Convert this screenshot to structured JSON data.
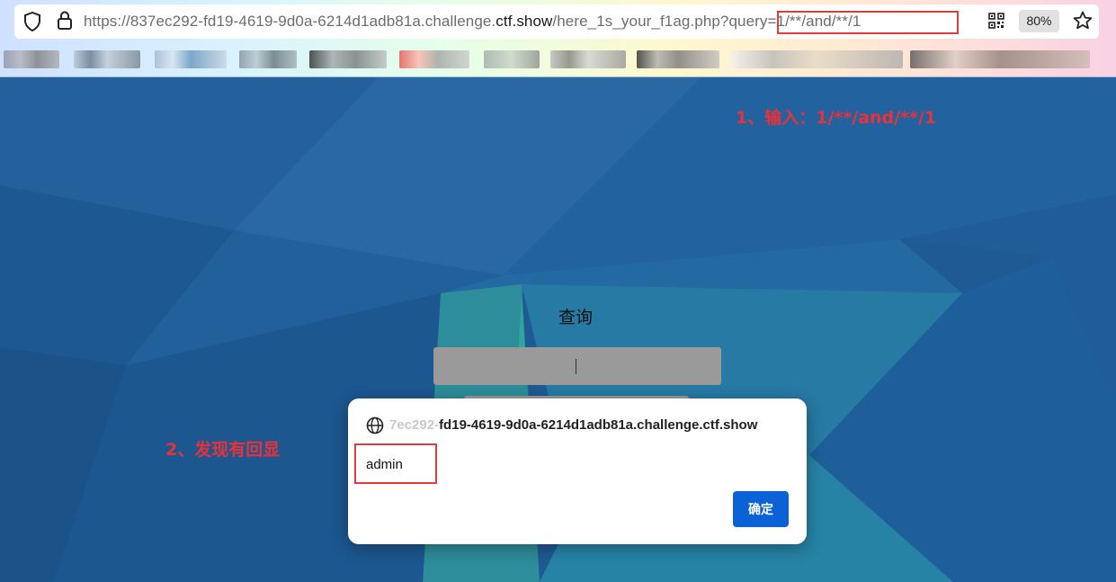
{
  "browser": {
    "url_prefix": "https://837ec292-fd19-4619-9d0a-6214d1adb81a.challenge.",
    "url_host": "ctf.show",
    "url_path": "/here_1s_your_f1ag.php?",
    "url_query": "query=1/**/and/**/1",
    "zoom": "80%",
    "icons": [
      "shield-icon",
      "lock-icon",
      "qr-code-icon",
      "star-icon"
    ]
  },
  "page": {
    "query_title": "查询",
    "input_value": "|"
  },
  "annotations": {
    "step1": "1、输入：1/**/and/**/1",
    "step2": "2、发现有回显",
    "color": "#e8323a"
  },
  "dialog": {
    "origin_faded": "7ec292-",
    "origin": "fd19-4619-9d0a-6214d1adb81a.challenge.ctf.show",
    "message": "admin",
    "ok_label": "确定",
    "accent": "#0b62d6"
  }
}
